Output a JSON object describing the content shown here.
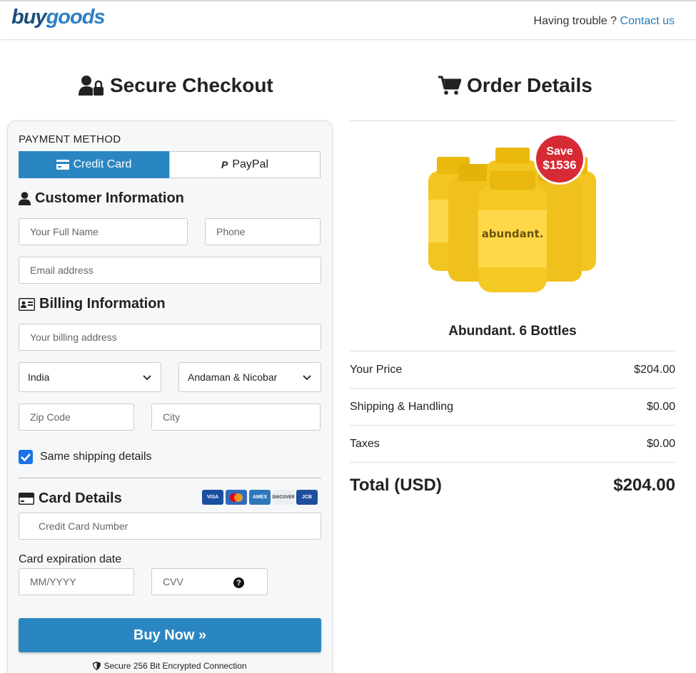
{
  "header": {
    "logo_buy": "buy",
    "logo_goods": "goods",
    "trouble_text": "Having trouble ?",
    "contact_link": "Contact us"
  },
  "checkout": {
    "title": "Secure Checkout",
    "payment_method_label": "PAYMENT METHOD",
    "tabs": [
      {
        "label": "Credit Card",
        "active": true
      },
      {
        "label": "PayPal",
        "active": false
      }
    ],
    "customer_title": "Customer Information",
    "full_name_placeholder": "Your Full Name",
    "phone_placeholder": "Phone",
    "email_placeholder": "Email address",
    "billing_title": "Billing Information",
    "billing_address_placeholder": "Your billing address",
    "country_value": "India",
    "state_value": "Andaman & Nicobar",
    "zip_placeholder": "Zip Code",
    "city_placeholder": "City",
    "same_shipping_label": "Same shipping details",
    "same_shipping_checked": true,
    "card_title": "Card Details",
    "card_brands": [
      "VISA",
      "MC",
      "AMEX",
      "DISCOVER",
      "JCB"
    ],
    "card_number_placeholder": "Credit Card Number",
    "expiration_label": "Card expiration date",
    "expiry_placeholder": "MM/YYYY",
    "cvv_placeholder": "CVV",
    "cvv_help": "?",
    "buy_button": "Buy Now »",
    "secure_note": "Secure 256 Bit Encrypted Connection"
  },
  "order": {
    "title": "Order Details",
    "save_badge_line1": "Save",
    "save_badge_line2": "$1536",
    "bottle_label": "abundant.",
    "product_name": "Abundant. 6 Bottles",
    "rows": [
      {
        "label": "Your Price",
        "value": "$204.00"
      },
      {
        "label": "Shipping & Handling",
        "value": "$0.00"
      },
      {
        "label": "Taxes",
        "value": "$0.00"
      }
    ],
    "total_label": "Total (USD)",
    "total_value": "$204.00"
  },
  "colors": {
    "primary": "#2a86c1",
    "badge": "#d62b35",
    "bottle": "#f3c521"
  }
}
